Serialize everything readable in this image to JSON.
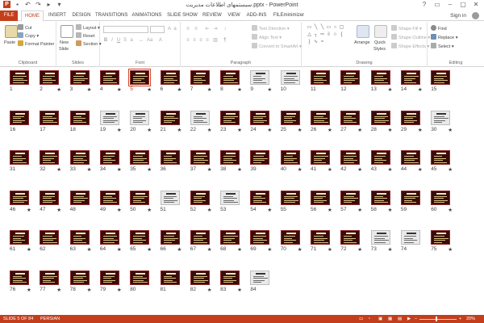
{
  "window": {
    "title": "سیستمهای اطلاعات مدیریت.pptx - PowerPoint",
    "app_logo": "P",
    "qat_icons": [
      "save-icon",
      "undo-icon",
      "redo-icon",
      "start-from-beginning-icon",
      "customize-qat-icon"
    ],
    "controls": [
      "?",
      "▭",
      "–",
      "▢",
      "✕"
    ]
  },
  "tabs": [
    {
      "label": "FILE"
    },
    {
      "label": "HOME"
    },
    {
      "label": "INSERT"
    },
    {
      "label": "DESIGN"
    },
    {
      "label": "TRANSITIONS"
    },
    {
      "label": "ANIMATIONS"
    },
    {
      "label": "SLIDE SHOW"
    },
    {
      "label": "REVIEW"
    },
    {
      "label": "VIEW"
    },
    {
      "label": "ADD-INS"
    },
    {
      "label": "FILEminimizer"
    }
  ],
  "active_tab": "HOME",
  "account": {
    "sign_in": "Sign in"
  },
  "ribbon": {
    "clipboard": {
      "label": "Clipboard",
      "paste": "Paste",
      "cut": "Cut",
      "copy": "Copy",
      "format_painter": "Format Painter"
    },
    "slides": {
      "label": "Slides",
      "new_slide_1": "New",
      "new_slide_2": "Slide",
      "layout": "Layout",
      "reset": "Reset",
      "section": "Section"
    },
    "font": {
      "label": "Font"
    },
    "paragraph": {
      "label": "Paragraph",
      "text_direction": "Text Direction",
      "align_text": "Align Text",
      "convert_smartart": "Convert to SmartArt"
    },
    "drawing": {
      "label": "Drawing",
      "arrange": "Arrange",
      "quick_styles_1": "Quick",
      "quick_styles_2": "Styles",
      "shape_fill": "Shape Fill",
      "shape_outline": "Shape Outline",
      "shape_effects": "Shape Effects"
    },
    "editing": {
      "label": "Editing",
      "find": "Find",
      "replace": "Replace",
      "select": "Select"
    }
  },
  "slides": {
    "selected": 5,
    "light_slides": [
      9,
      10,
      19,
      20,
      22,
      30,
      51,
      53,
      73,
      74,
      84
    ],
    "items": [
      {
        "n": "1",
        "star": ""
      },
      {
        "n": "2",
        "star": "★"
      },
      {
        "n": "3",
        "star": "★"
      },
      {
        "n": "4",
        "star": "★"
      },
      {
        "n": "5",
        "star": "★"
      },
      {
        "n": "6",
        "star": "★"
      },
      {
        "n": "7",
        "star": "★"
      },
      {
        "n": "8",
        "star": "★"
      },
      {
        "n": "9",
        "star": "★"
      },
      {
        "n": "10",
        "star": ""
      },
      {
        "n": "11",
        "star": ""
      },
      {
        "n": "12",
        "star": ""
      },
      {
        "n": "13",
        "star": "★"
      },
      {
        "n": "14",
        "star": "★"
      },
      {
        "n": "15",
        "star": ""
      },
      {
        "n": "16",
        "star": ""
      },
      {
        "n": "17",
        "star": ""
      },
      {
        "n": "18",
        "star": ""
      },
      {
        "n": "19",
        "star": "★"
      },
      {
        "n": "20",
        "star": "★"
      },
      {
        "n": "21",
        "star": "★"
      },
      {
        "n": "22",
        "star": "★"
      },
      {
        "n": "23",
        "star": "★"
      },
      {
        "n": "24",
        "star": "★"
      },
      {
        "n": "25",
        "star": "★"
      },
      {
        "n": "26",
        "star": "★"
      },
      {
        "n": "27",
        "star": "★"
      },
      {
        "n": "28",
        "star": "★"
      },
      {
        "n": "29",
        "star": "★"
      },
      {
        "n": "30",
        "star": "★"
      },
      {
        "n": "31",
        "star": ""
      },
      {
        "n": "32",
        "star": "★"
      },
      {
        "n": "33",
        "star": "★"
      },
      {
        "n": "34",
        "star": "★"
      },
      {
        "n": "35",
        "star": "★"
      },
      {
        "n": "36",
        "star": ""
      },
      {
        "n": "37",
        "star": "★"
      },
      {
        "n": "38",
        "star": "★"
      },
      {
        "n": "39",
        "star": ""
      },
      {
        "n": "40",
        "star": "★"
      },
      {
        "n": "41",
        "star": "★"
      },
      {
        "n": "42",
        "star": "★"
      },
      {
        "n": "43",
        "star": "★"
      },
      {
        "n": "44",
        "star": "★"
      },
      {
        "n": "45",
        "star": "★"
      },
      {
        "n": "46",
        "star": "★"
      },
      {
        "n": "47",
        "star": "★"
      },
      {
        "n": "48",
        "star": ""
      },
      {
        "n": "49",
        "star": "★"
      },
      {
        "n": "50",
        "star": "★"
      },
      {
        "n": "51",
        "star": ""
      },
      {
        "n": "52",
        "star": "★"
      },
      {
        "n": "53",
        "star": ""
      },
      {
        "n": "54",
        "star": "★"
      },
      {
        "n": "55",
        "star": ""
      },
      {
        "n": "56",
        "star": "★"
      },
      {
        "n": "57",
        "star": "★"
      },
      {
        "n": "58",
        "star": "★"
      },
      {
        "n": "59",
        "star": ""
      },
      {
        "n": "60",
        "star": "★"
      },
      {
        "n": "61",
        "star": "★"
      },
      {
        "n": "62",
        "star": ""
      },
      {
        "n": "63",
        "star": "★"
      },
      {
        "n": "64",
        "star": "★"
      },
      {
        "n": "65",
        "star": "★"
      },
      {
        "n": "66",
        "star": "★"
      },
      {
        "n": "67",
        "star": "★"
      },
      {
        "n": "68",
        "star": "★"
      },
      {
        "n": "69",
        "star": "★"
      },
      {
        "n": "70",
        "star": "★"
      },
      {
        "n": "71",
        "star": "★"
      },
      {
        "n": "72",
        "star": "★"
      },
      {
        "n": "73",
        "star": "★"
      },
      {
        "n": "74",
        "star": ""
      },
      {
        "n": "75",
        "star": "★"
      },
      {
        "n": "76",
        "star": "★"
      },
      {
        "n": "77",
        "star": "★"
      },
      {
        "n": "78",
        "star": "★"
      },
      {
        "n": "79",
        "star": "★"
      },
      {
        "n": "80",
        "star": ""
      },
      {
        "n": "81",
        "star": ""
      },
      {
        "n": "82",
        "star": "★"
      },
      {
        "n": "83",
        "star": "★"
      },
      {
        "n": "84",
        "star": ""
      }
    ]
  },
  "status": {
    "slide_info": "SLIDE 5 OF 84",
    "language": "PERSIAN",
    "zoom_minus": "–",
    "zoom_plus": "+",
    "zoom": "20%"
  },
  "colors": {
    "accent": "#c43e1c",
    "thumb_dark": "#3a0b0b",
    "thumb_light": "#e9e9e9"
  }
}
